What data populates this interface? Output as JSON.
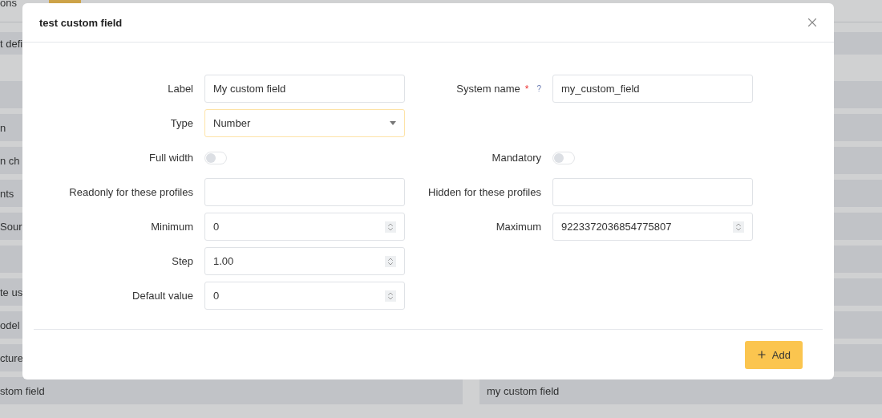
{
  "background": {
    "header_text": "ons",
    "section_text": "t defi",
    "rows": [
      {
        "left": "",
        "right": ""
      },
      {
        "left": "n",
        "right": ""
      },
      {
        "left": "n ch",
        "right": ""
      },
      {
        "left": "nts",
        "right": ""
      },
      {
        "left": "Sour",
        "right": ""
      },
      {
        "left": "",
        "right": ""
      },
      {
        "left": "te us",
        "right": ""
      },
      {
        "left": "odel",
        "right": ""
      },
      {
        "left": "cture",
        "right": ""
      },
      {
        "left": "stom field",
        "right": "my custom field"
      }
    ]
  },
  "dialog": {
    "title": "test custom field",
    "rows": [
      {
        "left": {
          "kind": "text",
          "label": "Label",
          "value": "My custom field"
        },
        "right": {
          "kind": "text",
          "label": "System name",
          "required": "*",
          "help": "?",
          "value": "my_custom_field"
        }
      },
      {
        "left": {
          "kind": "select",
          "label": "Type",
          "value": "Number"
        }
      },
      {
        "left": {
          "kind": "toggle",
          "label": "Full width",
          "on": false
        },
        "right": {
          "kind": "toggle",
          "label": "Mandatory",
          "on": false
        }
      },
      {
        "left": {
          "kind": "text",
          "label": "Readonly for these profiles"
        },
        "right": {
          "kind": "text",
          "label": "Hidden for these profiles"
        }
      },
      {
        "left": {
          "kind": "number",
          "label": "Minimum",
          "value": "0"
        },
        "right": {
          "kind": "number",
          "label": "Maximum",
          "value": "9223372036854775807"
        }
      },
      {
        "left": {
          "kind": "number",
          "label": "Step",
          "value": "1.00"
        }
      },
      {
        "left": {
          "kind": "number",
          "label": "Default value",
          "value": "0"
        }
      }
    ],
    "add_button": "Add"
  }
}
